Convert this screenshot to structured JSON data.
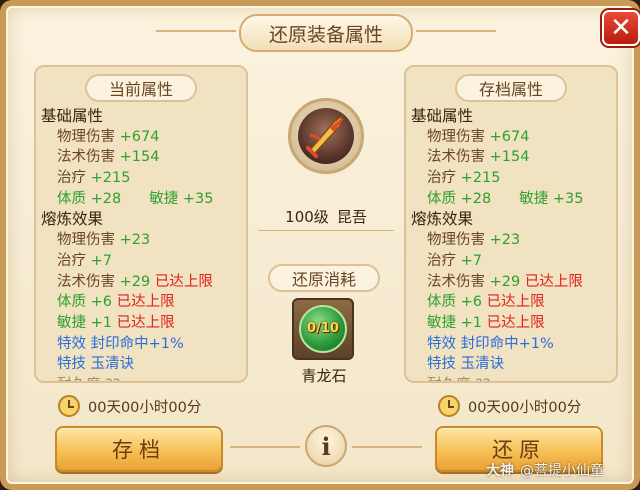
{
  "title": "还原装备属性",
  "close_label": "✕",
  "left_panel": {
    "header": "当前属性",
    "base_label": "基础属性",
    "physical": {
      "label": "物理伤害",
      "value": "+674"
    },
    "magic": {
      "label": "法术伤害",
      "value": "+154"
    },
    "heal": {
      "label": "治疗",
      "value": "+215"
    },
    "con": {
      "label": "体质",
      "value": "+28"
    },
    "agi": {
      "label": "敏捷",
      "value": "+35"
    },
    "refine_label": "熔炼效果",
    "r_physical": {
      "label": "物理伤害",
      "value": "+23"
    },
    "r_heal": {
      "label": "治疗",
      "value": "+7"
    },
    "r_magic": {
      "label": "法术伤害",
      "value": "+29",
      "cap": "已达上限"
    },
    "r_con": {
      "label": "体质",
      "value": "+6",
      "cap": "已达上限"
    },
    "r_agi": {
      "label": "敏捷",
      "value": "+1",
      "cap": "已达上限"
    },
    "effect": {
      "label": "特效",
      "value": "封印命中+1%"
    },
    "skill": {
      "label": "特技",
      "value": "玉清诀"
    },
    "durability_partial": "耐久度 ??"
  },
  "right_panel": {
    "header": "存档属性",
    "base_label": "基础属性",
    "physical": {
      "label": "物理伤害",
      "value": "+674"
    },
    "magic": {
      "label": "法术伤害",
      "value": "+154"
    },
    "heal": {
      "label": "治疗",
      "value": "+215"
    },
    "con": {
      "label": "体质",
      "value": "+28"
    },
    "agi": {
      "label": "敏捷",
      "value": "+35"
    },
    "refine_label": "熔炼效果",
    "r_physical": {
      "label": "物理伤害",
      "value": "+23"
    },
    "r_heal": {
      "label": "治疗",
      "value": "+7"
    },
    "r_magic": {
      "label": "法术伤害",
      "value": "+29",
      "cap": "已达上限"
    },
    "r_con": {
      "label": "体质",
      "value": "+6",
      "cap": "已达上限"
    },
    "r_agi": {
      "label": "敏捷",
      "value": "+1",
      "cap": "已达上限"
    },
    "effect": {
      "label": "特效",
      "value": "封印命中+1%"
    },
    "skill": {
      "label": "特技",
      "value": "玉清诀"
    },
    "durability_partial": "耐久度 ??"
  },
  "item": {
    "level": "100级",
    "name": "昆吾",
    "icon": "sword-emblem-icon"
  },
  "cost": {
    "header": "还原消耗",
    "count": "0/10",
    "name": "青龙石",
    "icon": "jade-orb-icon"
  },
  "timer_left": "00天00小时00分",
  "timer_right": "00天00小时00分",
  "buttons": {
    "save": "存档",
    "restore": "还原",
    "info": "i"
  },
  "watermark": {
    "brand": "大神",
    "handle": "@菩提小仙童"
  },
  "colors": {
    "accent_green": "#2fa12f",
    "cap_red": "#e0221a",
    "effect_blue": "#2a6ed8",
    "button_gold": "#f7c056"
  }
}
